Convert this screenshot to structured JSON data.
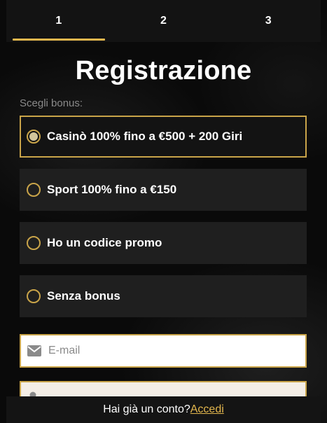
{
  "steps": [
    {
      "label": "1",
      "active": true
    },
    {
      "label": "2",
      "active": false
    },
    {
      "label": "3",
      "active": false
    }
  ],
  "title": "Registrazione",
  "bonus_prompt": "Scegli bonus:",
  "bonus_options": [
    {
      "label": "Casinò 100% fino a €500 + 200 Giri",
      "selected": true
    },
    {
      "label": "Sport 100% fino a €150",
      "selected": false
    },
    {
      "label": "Ho un codice promo",
      "selected": false
    },
    {
      "label": "Senza bonus",
      "selected": false
    }
  ],
  "email_field": {
    "placeholder": "E-mail",
    "value": "",
    "icon": "envelope-icon"
  },
  "second_field": {
    "placeholder": "",
    "value": "",
    "icon": "user-icon"
  },
  "footer": {
    "text": "Hai già un conto?",
    "link": "Accedi"
  },
  "colors": {
    "accent": "#e2b64d",
    "border": "#c9a449",
    "card": "#1f1f1f",
    "background": "#0b0b0b"
  }
}
